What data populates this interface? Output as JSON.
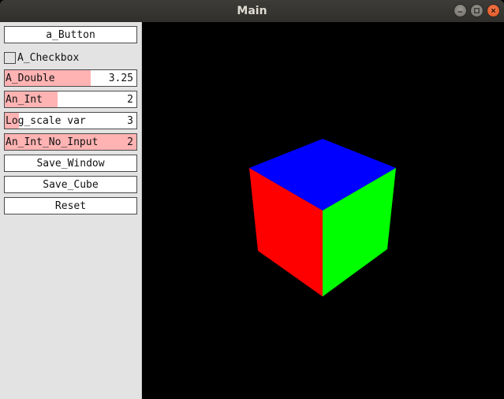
{
  "window": {
    "title": "Main"
  },
  "panel": {
    "button": "a_Button",
    "checkbox": {
      "label": "A_Checkbox",
      "checked": false
    },
    "sliders": [
      {
        "label": "A_Double",
        "value": "3.25",
        "fraction": 0.65
      },
      {
        "label": "An_Int",
        "value": "2",
        "fraction": 0.4
      },
      {
        "label": "Log_scale var",
        "value": "3",
        "fraction": 0.11
      },
      {
        "label": "An_Int_No_Input",
        "value": "2",
        "fraction": 1.0
      }
    ],
    "save_window": "Save_Window",
    "save_cube": "Save_Cube",
    "reset": "Reset"
  },
  "scene": {
    "object": "cube",
    "face_colors": {
      "top": "#0000ff",
      "left": "#ff0000",
      "right": "#00ff00"
    },
    "background": "#000000"
  }
}
